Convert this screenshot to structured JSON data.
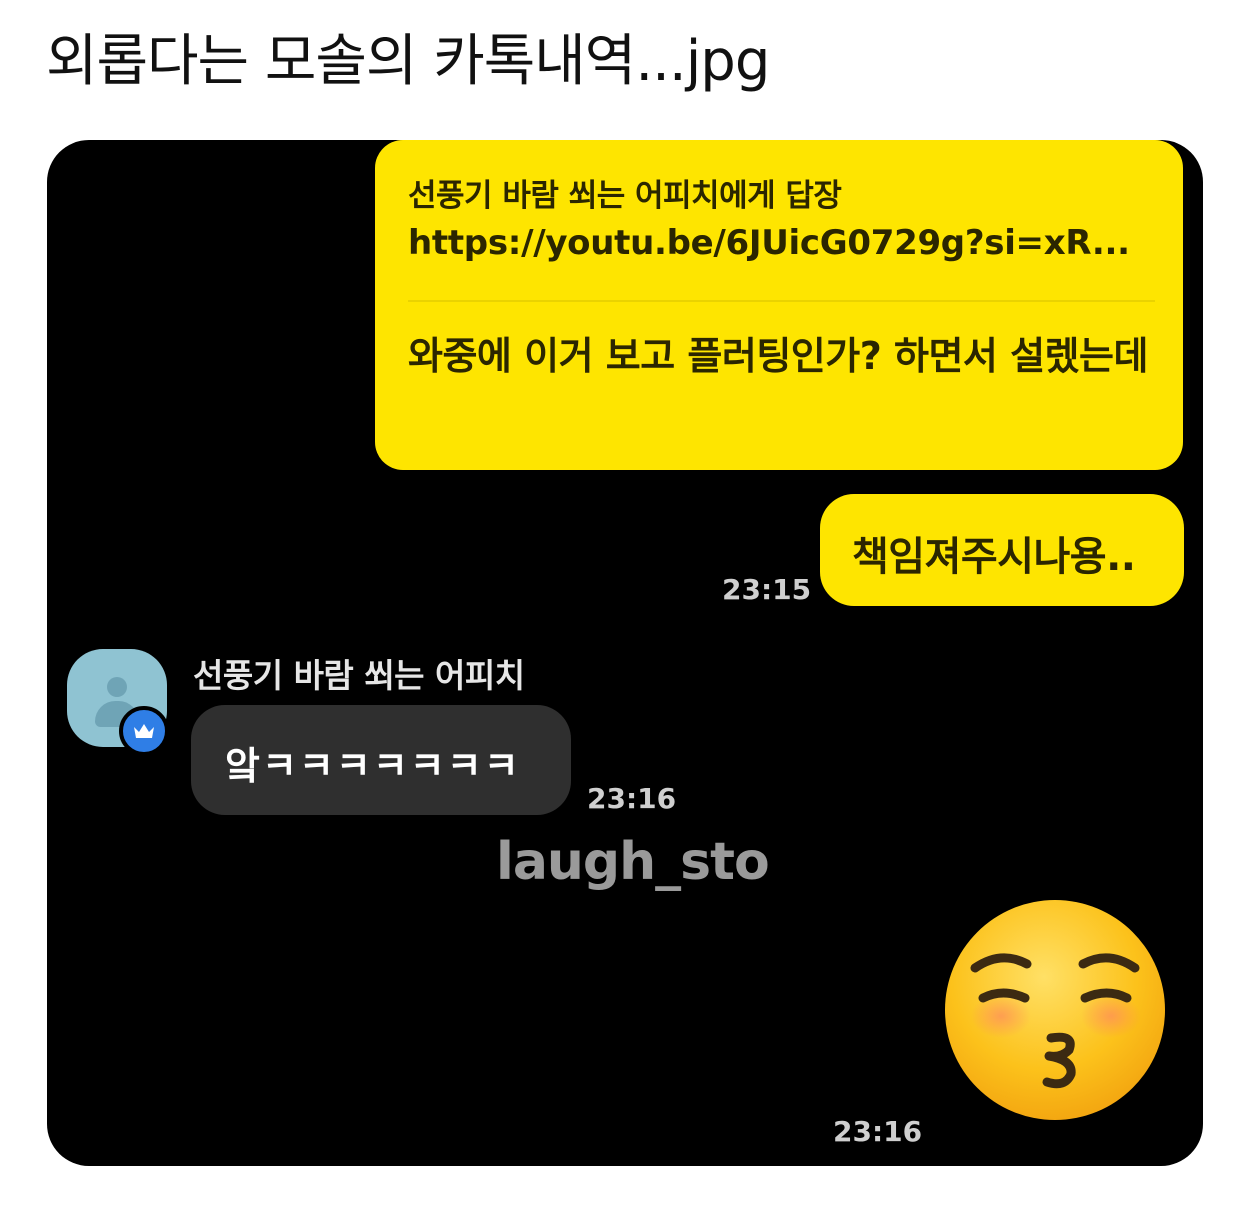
{
  "post": {
    "title": "외롭다는 모솔의 카톡내역...jpg"
  },
  "chat": {
    "reply": {
      "reply_to": "선풍기 바람 쐬는 어피치에게 답장",
      "link": "https://youtu.be/6JUicG0729g?si=xR...",
      "message": "와중에 이거 보고 플러팅인가? 하면서 설렜는데"
    },
    "sent_message_2": "책임져주시나용..",
    "time_1": "23:15",
    "received": {
      "sender_name": "선풍기 바람 쐬는 어피치",
      "message": "앜ㅋㅋㅋㅋㅋㅋㅋ",
      "time": "23:16"
    },
    "emoji_time": "23:16",
    "watermark": "laugh_sto"
  },
  "colors": {
    "chat_background": "#000000",
    "sent_bubble": "#fee500",
    "received_bubble": "#2f2f2f",
    "badge": "#2f7ee6",
    "avatar": "#8fc3d2"
  },
  "icons": {
    "avatar": "default-profile-icon",
    "badge": "crown-icon",
    "sticker": "kissing-face-closed-eyes-emoji"
  }
}
